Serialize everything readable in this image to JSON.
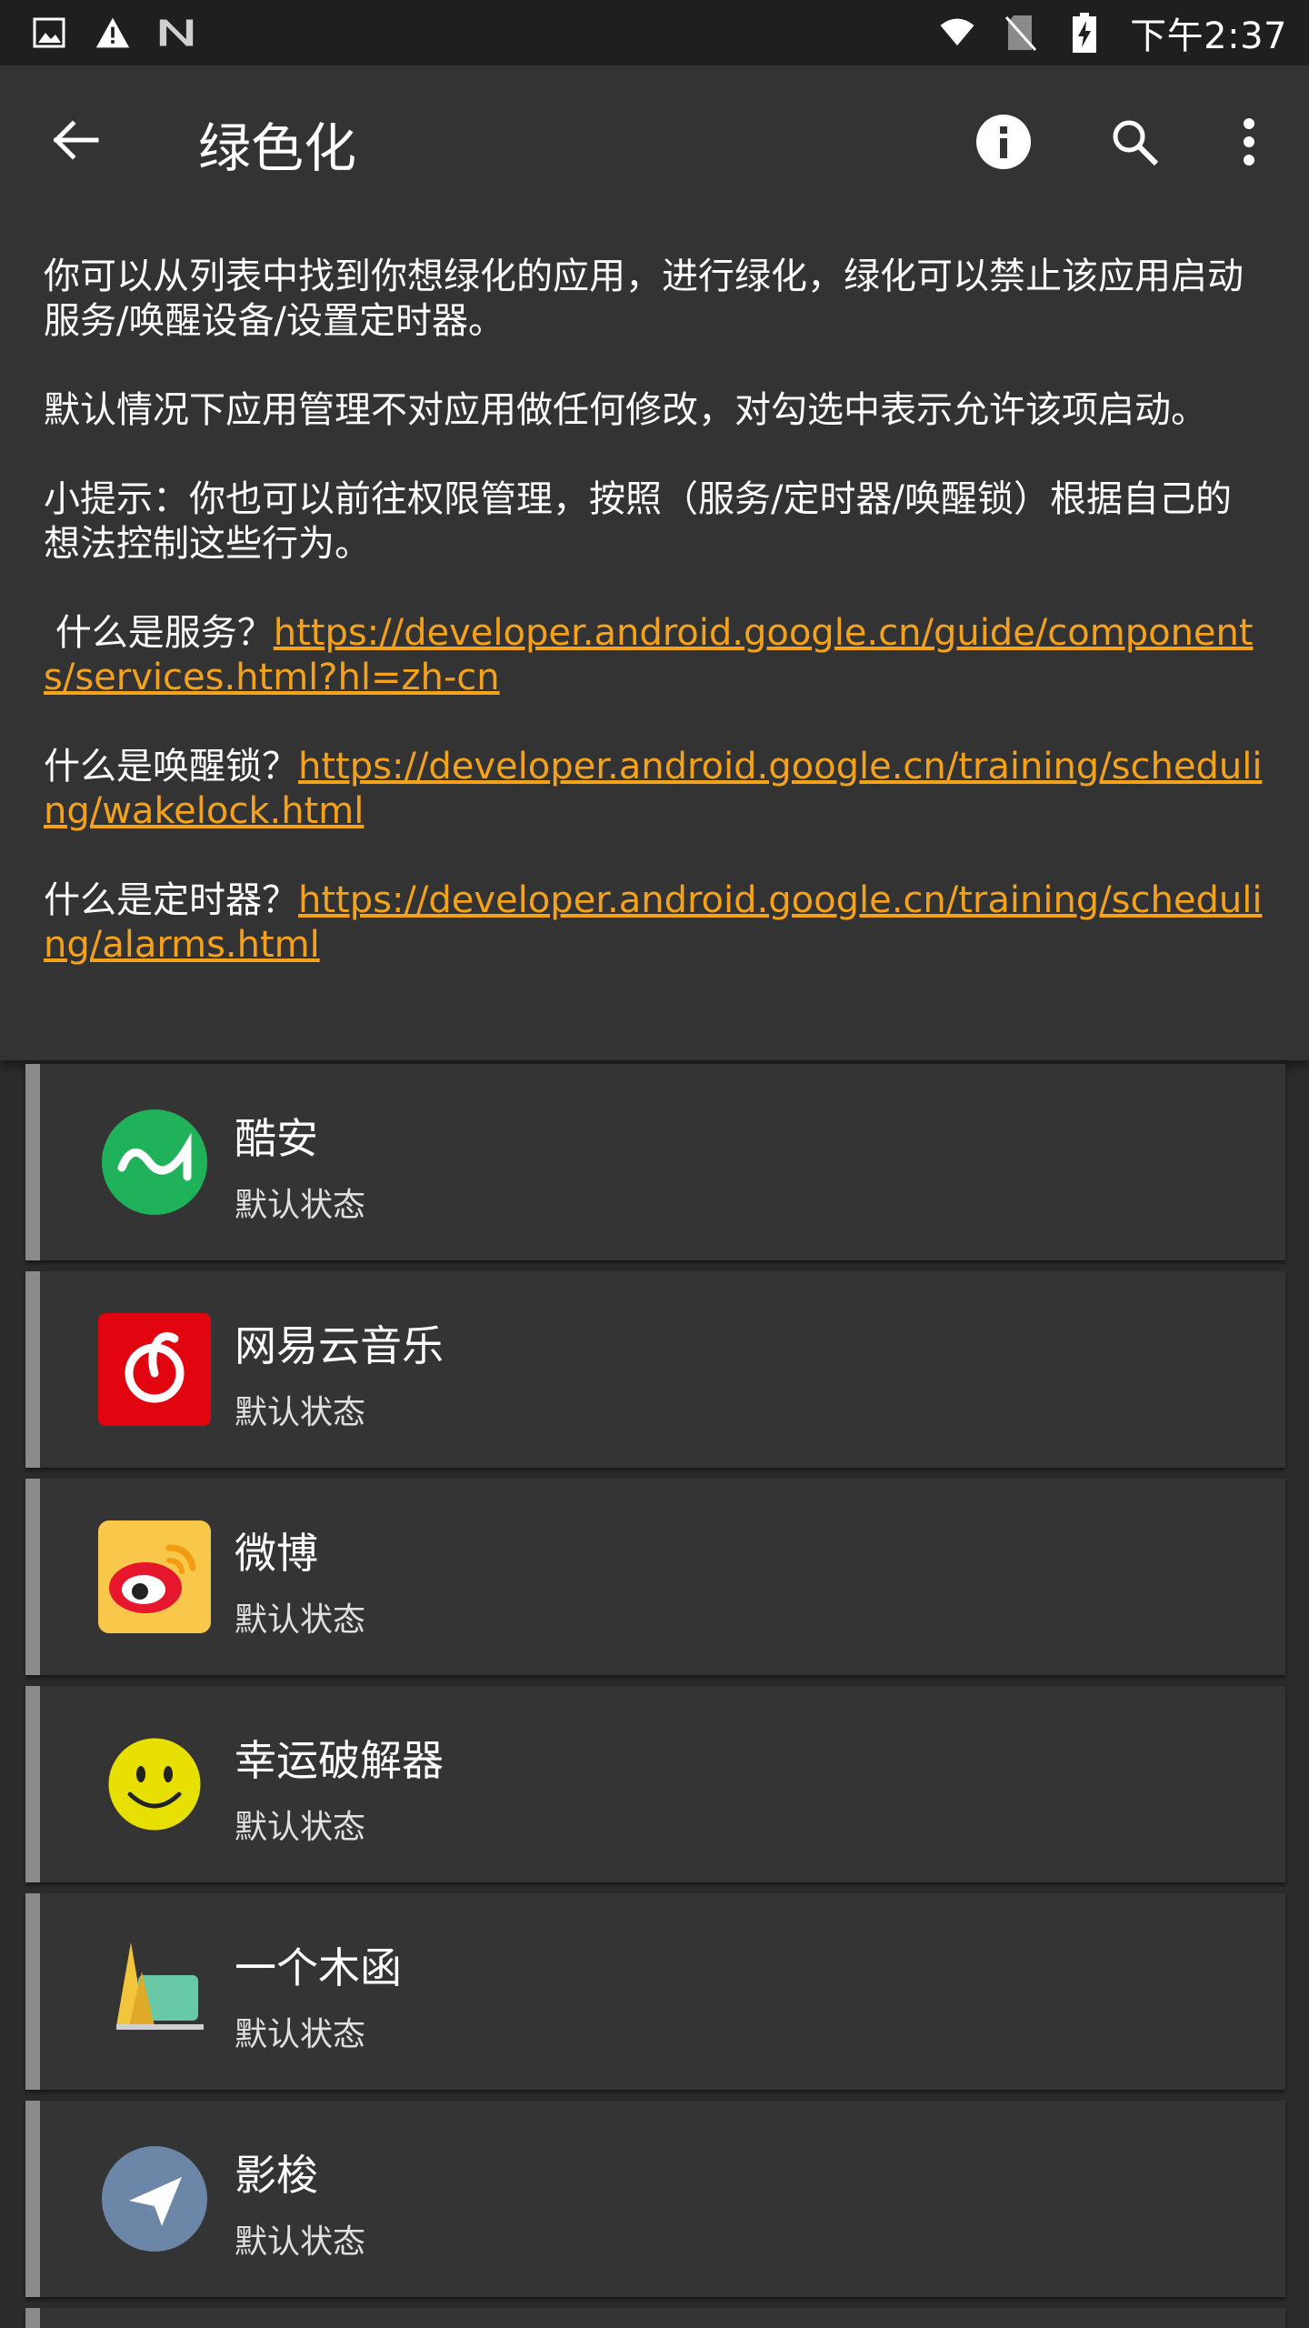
{
  "status_bar": {
    "time": "下午2:37",
    "left_icons": [
      "image-icon",
      "warning-icon",
      "n-logo-icon"
    ],
    "right_icons": [
      "wifi-icon",
      "no-sim-icon",
      "battery-charging-icon"
    ]
  },
  "app_bar": {
    "title": "绿色化",
    "back_icon": "arrow-back-icon",
    "actions": [
      "info-icon",
      "search-icon",
      "more-vert-icon"
    ]
  },
  "description": {
    "p1": "你可以从列表中找到你想绿化的应用，进行绿化，绿化可以禁止该应用启动服务/唤醒设备/设置定时器。",
    "p2": "默认情况下应用管理不对应用做任何修改，对勾选中表示允许该项启动。",
    "p3": "小提示：你也可以前往权限管理，按照（服务/定时器/唤醒锁）根据自己的想法控制这些行为。",
    "service_label": " 什么是服务？",
    "service_link": "https://developer.android.google.cn/guide/components/services.html?hl=zh-cn",
    "wakelock_label": "什么是唤醒锁？",
    "wakelock_link": "https://developer.android.google.cn/training/scheduling/wakelock.html",
    "alarm_label": "什么是定时器？",
    "alarm_link": "https://developer.android.google.cn/training/scheduling/alarms.html"
  },
  "apps": [
    {
      "name": "酷安",
      "status": "默认状态",
      "icon": "coolapk-icon"
    },
    {
      "name": "网易云音乐",
      "status": "默认状态",
      "icon": "netease-music-icon"
    },
    {
      "name": "微博",
      "status": "默认状态",
      "icon": "weibo-icon"
    },
    {
      "name": "幸运破解器",
      "status": "默认状态",
      "icon": "lucky-patcher-icon"
    },
    {
      "name": "一个木函",
      "status": "默认状态",
      "icon": "woodbox-icon"
    },
    {
      "name": "影梭",
      "status": "默认状态",
      "icon": "shadowsocks-icon"
    }
  ],
  "colors": {
    "link": "#f4a21a",
    "background": "#2b2b2b",
    "card": "#343434",
    "app_bar": "#333333"
  }
}
